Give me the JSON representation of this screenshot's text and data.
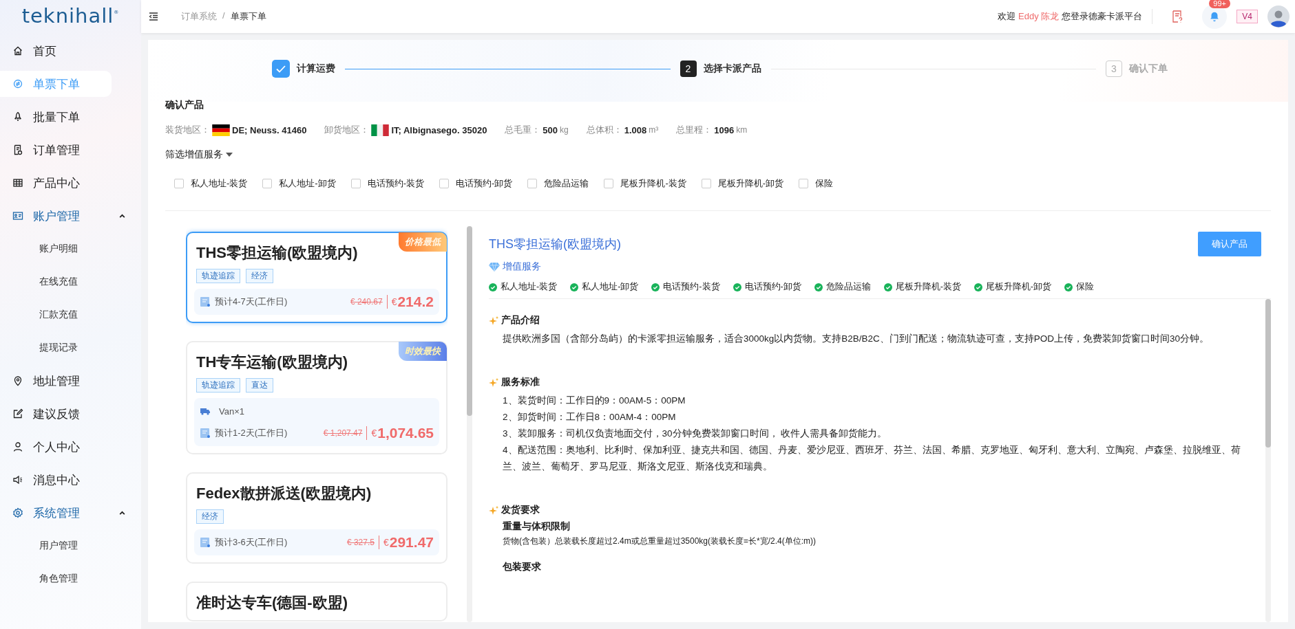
{
  "logo": "teknihall",
  "logo_mark": "®",
  "sidebar": {
    "items": [
      {
        "label": "首页",
        "selected": false
      },
      {
        "label": "单票下单",
        "selected": true
      },
      {
        "label": "批量下单",
        "selected": false
      },
      {
        "label": "订单管理",
        "selected": false
      },
      {
        "label": "产品中心",
        "selected": false
      },
      {
        "label": "账户管理",
        "selected": false,
        "expanded": true,
        "children": [
          {
            "label": "账户明细",
            "selected": false
          },
          {
            "label": "在线充值",
            "selected": false
          },
          {
            "label": "汇款充值",
            "selected": false
          },
          {
            "label": "提现记录",
            "selected": false
          }
        ]
      },
      {
        "label": "地址管理",
        "selected": false
      },
      {
        "label": "建议反馈",
        "selected": false
      },
      {
        "label": "个人中心",
        "selected": false
      },
      {
        "label": "消息中心",
        "selected": false
      },
      {
        "label": "系统管理",
        "selected": false,
        "expanded": true,
        "children": [
          {
            "label": "用户管理",
            "selected": false
          },
          {
            "label": "角色管理",
            "selected": false
          }
        ]
      }
    ]
  },
  "header": {
    "breadcrumb": [
      "订单系统",
      "单票下单"
    ],
    "breadcrumb_separator": "/",
    "welcome_prefix": "欢迎",
    "user": "Eddy 陈龙",
    "welcome_suffix": "您登录德豪卡派平台",
    "notification_count": "99+",
    "version": "V4"
  },
  "steps": [
    {
      "label": "计算运费",
      "done": true,
      "selected": false
    },
    {
      "number": "2",
      "label": "选择卡派产品",
      "done": false,
      "selected": true
    },
    {
      "number": "3",
      "label": "确认下单",
      "done": false,
      "selected": false
    }
  ],
  "confirm": {
    "title": "确认产品",
    "info": [
      {
        "label": "装货地区：",
        "value": "DE; Neuss. 41460"
      },
      {
        "label": "卸货地区：",
        "value": "IT; Albignasego. 35020"
      },
      {
        "label": "总毛重：",
        "value": "500",
        "unit": "kg"
      },
      {
        "label": "总体积：",
        "value": "1.008",
        "unit": "m³"
      },
      {
        "label": "总里程：",
        "value": "1096",
        "unit": "km"
      }
    ],
    "filter_label": "筛选增值服务",
    "services": [
      {
        "label": "私人地址-装货",
        "checked": false
      },
      {
        "label": "私人地址-卸货",
        "checked": false
      },
      {
        "label": "电话预约-装货",
        "checked": false
      },
      {
        "label": "电话预约-卸货",
        "checked": false
      },
      {
        "label": "危险品运输",
        "checked": false
      },
      {
        "label": "尾板升降机-装货",
        "checked": false
      },
      {
        "label": "尾板升降机-卸货",
        "checked": false
      },
      {
        "label": "保险",
        "checked": false
      }
    ]
  },
  "products": [
    {
      "title": "THS零担运输(欧盟境内)",
      "selected": true,
      "badge": {
        "text": "价格最低",
        "kind": "cheapest"
      },
      "tags": [
        "轨迹追踪",
        "经济"
      ],
      "eta": "预计4-7天(工作日)",
      "original_price": "€ 240.67",
      "currency": "€",
      "price": "214.2"
    },
    {
      "title": "TH专车运输(欧盟境内)",
      "selected": false,
      "badge": {
        "text": "时效最快",
        "kind": "fastest"
      },
      "tags": [
        "轨迹追踪",
        "直达"
      ],
      "vehicle": "Van×1",
      "eta": "预计1-2天(工作日)",
      "original_price": "€ 1,207.47",
      "currency": "€",
      "price": "1,074.65"
    },
    {
      "title": "Fedex散拼派送(欧盟境内)",
      "selected": false,
      "tags": [
        "经济"
      ],
      "eta": "预计3-6天(工作日)",
      "original_price": "€ 327.5",
      "currency": "€",
      "price": "291.47"
    },
    {
      "title": "准时达专车(德国-欧盟)",
      "selected": false
    }
  ],
  "detail": {
    "title": "THS零担运输(欧盟境内)",
    "confirm_button": "确认产品",
    "services_label": "增值服务",
    "services": [
      "私人地址-装货",
      "私人地址-卸货",
      "电话预约-装货",
      "电话预约-卸货",
      "危险品运输",
      "尾板升降机-装货",
      "尾板升降机-卸货",
      "保险"
    ],
    "sections": [
      {
        "heading": "产品介绍",
        "paragraphs": [
          "提供欧洲多国（含部分岛屿）的卡派零担运输服务，适合3000kg以内货物。支持B2B/B2C、门到门配送；物流轨迹可查，支持POD上传，免费装卸货窗口时间30分钟。"
        ]
      },
      {
        "heading": "服务标准",
        "paragraphs": [
          "1、装货时间：工作日的9：00AM-5：00PM",
          "2、卸货时间：工作日8：00AM-4：00PM",
          "3、装卸服务：司机仅负责地面交付，30分钟免费装卸窗口时间， 收件人需具备卸货能力。",
          "4、配送范围：奥地利、比利时、保加利亚、捷克共和国、德国、丹麦、爱沙尼亚、西班牙、芬兰、法国、希腊、克罗地亚、匈牙利、意大利、立陶宛、卢森堡、拉脱维亚、荷兰、波兰、葡萄牙、罗马尼亚、斯洛文尼亚、斯洛伐克和瑞典。"
        ]
      },
      {
        "heading": "发货要求",
        "subsections": [
          {
            "heading": "重量与体积限制",
            "text": "货物(含包装）总装载长度超过2.4m或总重量超过3500kg(装载长度=长*宽/2.4(单位:m))"
          },
          {
            "heading": "包装要求"
          }
        ]
      }
    ]
  }
}
